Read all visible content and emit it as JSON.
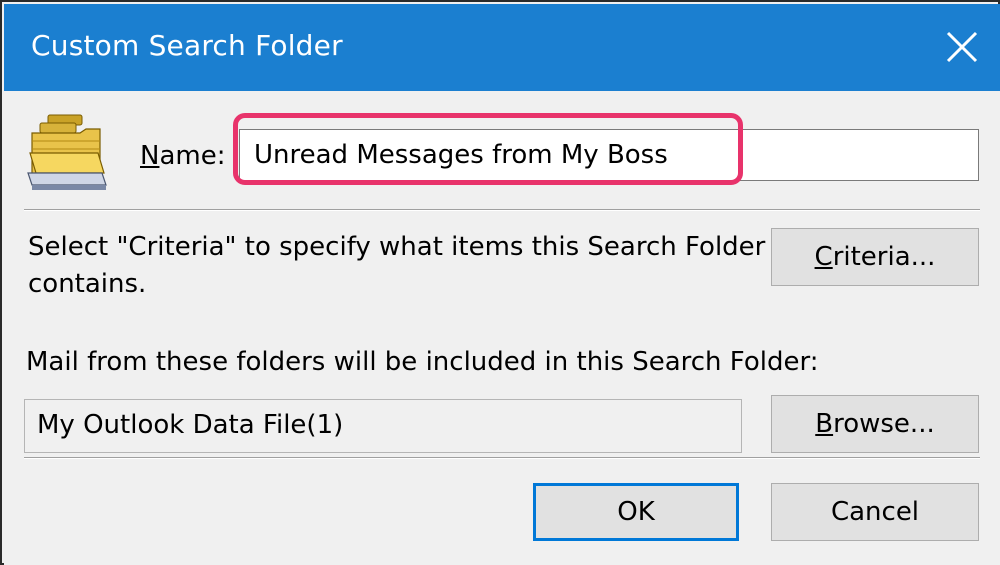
{
  "window": {
    "title": "Custom Search Folder",
    "close_label": "×"
  },
  "name_field": {
    "label_prefix": "",
    "label_accel": "N",
    "label_rest": "ame:",
    "value": "Unread Messages from My Boss"
  },
  "criteria": {
    "description": "Select \"Criteria\" to specify what items this Search Folder contains.",
    "button_accel": "C",
    "button_rest": "riteria..."
  },
  "mail_from": {
    "label": "Mail from these folders will be included in this Search Folder:",
    "value": "My Outlook Data File(1)",
    "browse_accel": "B",
    "browse_rest": "rowse..."
  },
  "footer": {
    "ok_label": "OK",
    "cancel_label": "Cancel"
  },
  "colors": {
    "titlebar": "#1b7fd0",
    "highlight": "#e8336b",
    "default_button_border": "#0078d7"
  },
  "icons": [
    "search-folder-icon",
    "close-icon"
  ]
}
